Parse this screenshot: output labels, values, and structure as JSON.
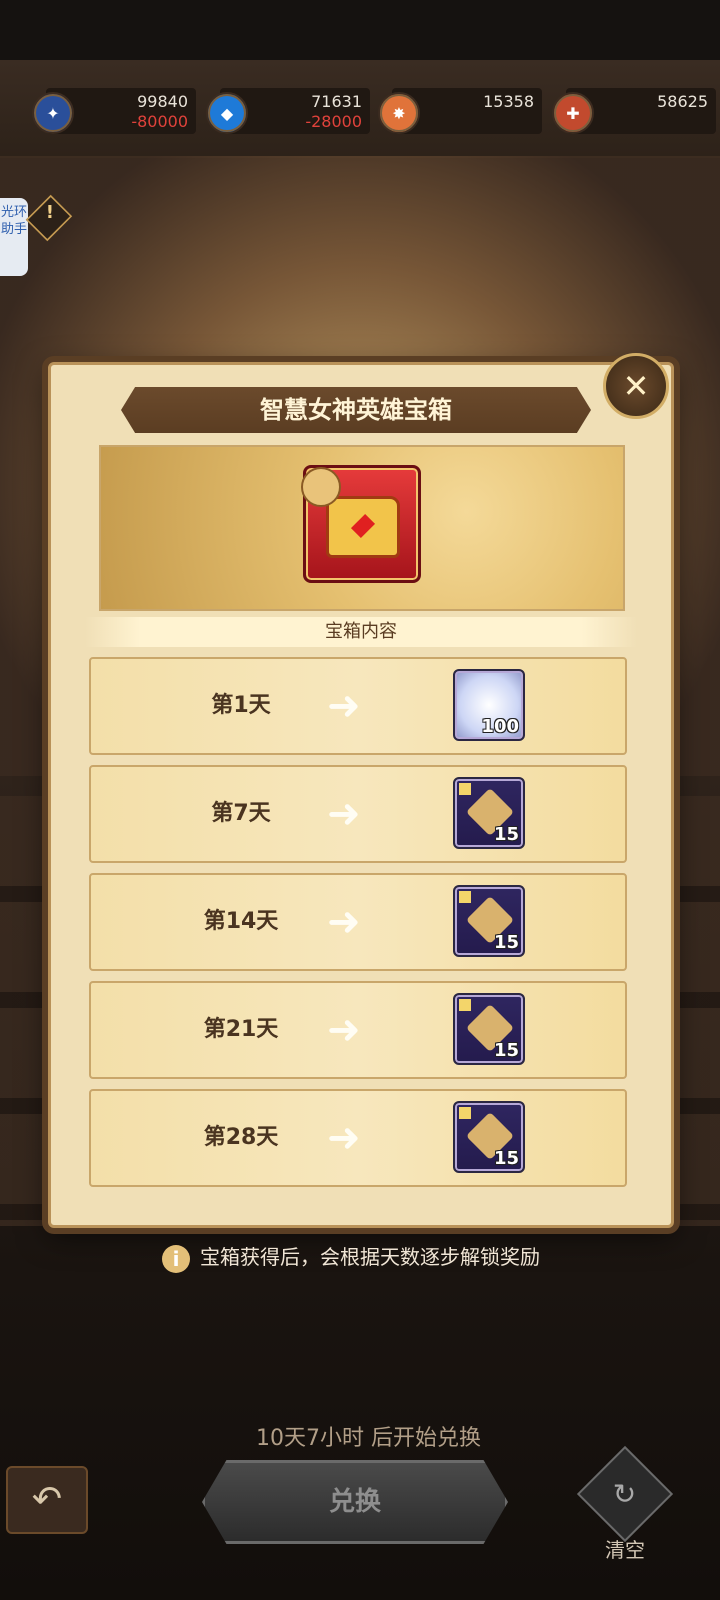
{
  "currencies": [
    {
      "value": "99840",
      "change": "-80000",
      "icon": "blue-scroll-icon",
      "color": "#2a4f9a"
    },
    {
      "value": "71631",
      "change": "-28000",
      "icon": "blue-crystal-icon",
      "color": "#1e7ad8"
    },
    {
      "value": "15358",
      "change": "",
      "icon": "orange-token-icon",
      "color": "#e0733a"
    },
    {
      "value": "58625",
      "change": "",
      "icon": "red-emblem-icon",
      "color": "#c24a2e"
    }
  ],
  "helper_tab": "光环助手",
  "modal": {
    "title": "智慧女神英雄宝箱",
    "section_header": "宝箱内容",
    "rows": [
      {
        "day": "第1天",
        "item_type": "diamond",
        "qty": "100"
      },
      {
        "day": "第7天",
        "item_type": "puzzle",
        "qty": "15"
      },
      {
        "day": "第14天",
        "item_type": "puzzle",
        "qty": "15"
      },
      {
        "day": "第21天",
        "item_type": "puzzle",
        "qty": "15"
      },
      {
        "day": "第28天",
        "item_type": "puzzle",
        "qty": "15"
      }
    ]
  },
  "note": "宝箱获得后，会根据天数逐步解锁奖励",
  "footer": {
    "countdown": "10天7小时 后开始兑换",
    "exchange_label": "兑换",
    "clear_label": "清空"
  }
}
